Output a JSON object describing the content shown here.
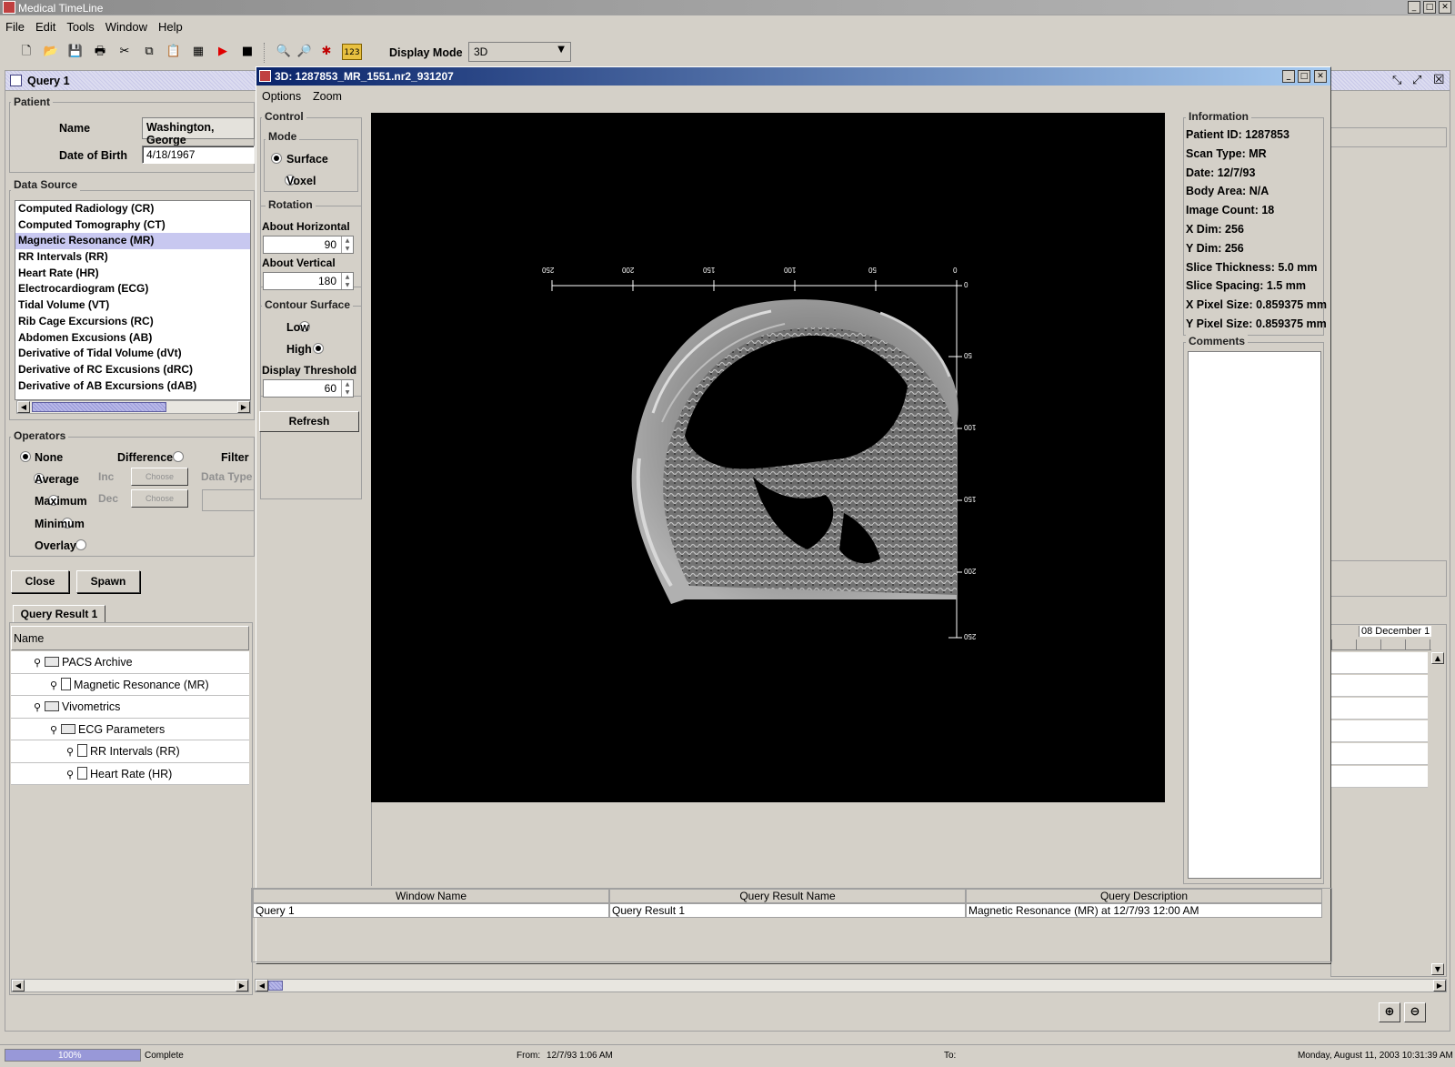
{
  "app": {
    "title": "Medical TimeLine",
    "window_controls": [
      "_",
      "□",
      "✕"
    ]
  },
  "menu": [
    "File",
    "Edit",
    "Tools",
    "Window",
    "Help"
  ],
  "toolbar": {
    "display_mode_label": "Display Mode",
    "display_mode_value": "3D"
  },
  "query_window": {
    "title": "Query 1",
    "patient": {
      "group_label": "Patient",
      "name_label": "Name",
      "name_value": "Washington, George",
      "dob_label": "Date of Birth",
      "dob_value": "4/18/1967"
    },
    "data_source": {
      "group_label": "Data Source",
      "items": [
        "Computed Radiology (CR)",
        "Computed Tomography (CT)",
        "Magnetic Resonance (MR)",
        "RR Intervals (RR)",
        "Heart Rate (HR)",
        "Electrocardiogram (ECG)",
        "Tidal Volume (VT)",
        "Rib Cage Excursions (RC)",
        "Abdomen Excusions (AB)",
        "Derivative of Tidal Volume (dVt)",
        "Derivative of RC Excusions (dRC)",
        "Derivative of AB Excursions (dAB)"
      ],
      "selected_index": 2
    },
    "operators": {
      "group_label": "Operators",
      "col1": [
        "None",
        "Average",
        "Maximum",
        "Minimum",
        "Overlay"
      ],
      "difference": "Difference",
      "filter": "Filter",
      "inc": "Inc",
      "dec": "Dec",
      "choose": "Choose",
      "data_type": "Data Type"
    },
    "close_label": "Close",
    "spawn_label": "Spawn",
    "result_tab": "Query Result 1",
    "tree_header": "Name",
    "tree": [
      {
        "label": "PACS Archive",
        "level": 0,
        "type": "folder"
      },
      {
        "label": "Magnetic Resonance (MR)",
        "level": 1,
        "type": "file"
      },
      {
        "label": "Vivometrics",
        "level": 0,
        "type": "folder"
      },
      {
        "label": "ECG Parameters",
        "level": 1,
        "type": "folder"
      },
      {
        "label": "RR Intervals (RR)",
        "level": 2,
        "type": "file"
      },
      {
        "label": "Heart Rate (HR)",
        "level": 2,
        "type": "file"
      }
    ]
  },
  "viewer": {
    "title": "3D: 1287853_MR_1551.nr2_931207",
    "menu": [
      "Options",
      "Zoom"
    ],
    "control": {
      "group_label": "Control",
      "mode_label": "Mode",
      "mode_options": [
        "Surface",
        "Voxel"
      ],
      "rotation_label": "Rotation",
      "about_horizontal_label": "About Horizontal",
      "about_horizontal_value": "90",
      "about_vertical_label": "About Vertical",
      "about_vertical_value": "180",
      "contour_label": "Contour Surface",
      "contour_options": [
        "Low",
        "High"
      ],
      "threshold_label": "Display Threshold",
      "threshold_value": "60",
      "refresh_label": "Refresh"
    },
    "axis": {
      "top_ticks": [
        "250",
        "200",
        "150",
        "100",
        "50",
        "0"
      ],
      "right_ticks": [
        "0",
        "50",
        "100",
        "150",
        "200",
        "250"
      ]
    },
    "information": {
      "group_label": "Information",
      "lines": [
        "Patient ID: 1287853",
        "Scan Type: MR",
        "Date: 12/7/93",
        "Body Area: N/A",
        "Image Count: 18",
        "X Dim: 256",
        "Y Dim: 256",
        "Slice Thickness: 5.0 mm",
        "Slice Spacing: 1.5 mm",
        "X Pixel Size: 0.859375 mm",
        "Y Pixel Size: 0.859375 mm"
      ],
      "comments_label": "Comments"
    },
    "table": {
      "headers": [
        "Window Name",
        "Query Result Name",
        "Query Description"
      ],
      "row": [
        "Query 1",
        "Query Result 1",
        "Magnetic Resonance (MR) at 12/7/93 12:00 AM"
      ]
    }
  },
  "timeline": {
    "date_header": "08 December 1"
  },
  "statusbar": {
    "progress_percent": 100,
    "progress_text": "100%",
    "status": "Complete",
    "from_label": "From:",
    "from_value": "12/7/93 1:06 AM",
    "to_label": "To:",
    "datetime": "Monday, August 11, 2003 10:31:39 AM"
  }
}
